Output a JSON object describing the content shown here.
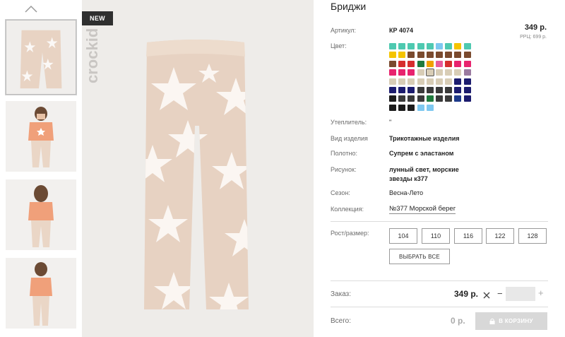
{
  "badge": "NEW",
  "brand": "crockid",
  "product": {
    "title": "Бриджи",
    "price_top": "349 р.",
    "rrp": "РРЦ: 699 р."
  },
  "specs": {
    "article_label": "Артикул:",
    "article_value": "КР 4074",
    "color_label": "Цвет:",
    "insulation_label": "Утеплитель:",
    "insulation_value": "\"",
    "type_label": "Вид изделия",
    "type_value": "Трикотажные изделия",
    "fabric_label": "Полотно:",
    "fabric_value": "Супрем с эластаном",
    "pattern_label": "Рисунок:",
    "pattern_value_line1": "лунный свет, морские",
    "pattern_value_line2": "звезды к377",
    "season_label": "Сезон:",
    "season_value": "Весна-Лето",
    "collection_label": "Коллекция:",
    "collection_value": "№377 Морской берег",
    "size_label": "Рост/размер:"
  },
  "sizes": [
    "104",
    "110",
    "116",
    "122",
    "128"
  ],
  "select_all": "ВЫБРАТЬ ВСЕ",
  "order": {
    "label": "Заказ:",
    "price": "349 р.",
    "minus": "−",
    "plus": "+",
    "qty": ""
  },
  "total": {
    "label": "Всего:",
    "price": "0 р.",
    "cart_button": "В КОРЗИНУ"
  },
  "colors": [
    "#4ec9b0",
    "#4ec9b0",
    "#4ec9b0",
    "#4ec9b0",
    "#4ec9b0",
    "#7ec8f0",
    "#4ec9b0",
    "#f5c400",
    "#4ec9b0",
    "#f5c400",
    "#f5c400",
    "#7a4a2e",
    "#7a4a2e",
    "#7a4a2e",
    "#7a4a2e",
    "#7a4a2e",
    "#7a4a2e",
    "#7a4a2e",
    "#7a4a2e",
    "#d62e2e",
    "#d62e2e",
    "#1e7a3c",
    "#f0a000",
    "#e85b9a",
    "#d62e2e",
    "#e8236e",
    "#e8236e",
    "#e8236e",
    "#e8236e",
    "#e8236e",
    "#d8cdb6",
    "#d8cdb6",
    "#d8cdb6",
    "#d8cdb6",
    "#d8cdb6",
    "#9a7aa0",
    "#d8cdb6",
    "#d8cdb6",
    "#d8cdb6",
    "#d8cdb6",
    "#d8cdb6",
    "#d8cdb6",
    "#d8cdb6",
    "#1c1c6e",
    "#1c1c6e",
    "#1c1c6e",
    "#1c1c6e",
    "#1c1c6e",
    "#3a3a3a",
    "#3a3a3a",
    "#3a3a3a",
    "#3a3a3a",
    "#1c1c6e",
    "#1c1c6e",
    "#1c1c1c",
    "#3a3a3a",
    "#3a3a3a",
    "#3a3a3a",
    "#1e7a3c",
    "#3a3a3a",
    "#3a3a3a",
    "#1e3a8a",
    "#1c1c6e",
    "#1c1c1c",
    "#1c1c1c",
    "#1c1c1c",
    "#7ec8f0",
    "#7ec8f0"
  ],
  "selected_color_index": 31
}
